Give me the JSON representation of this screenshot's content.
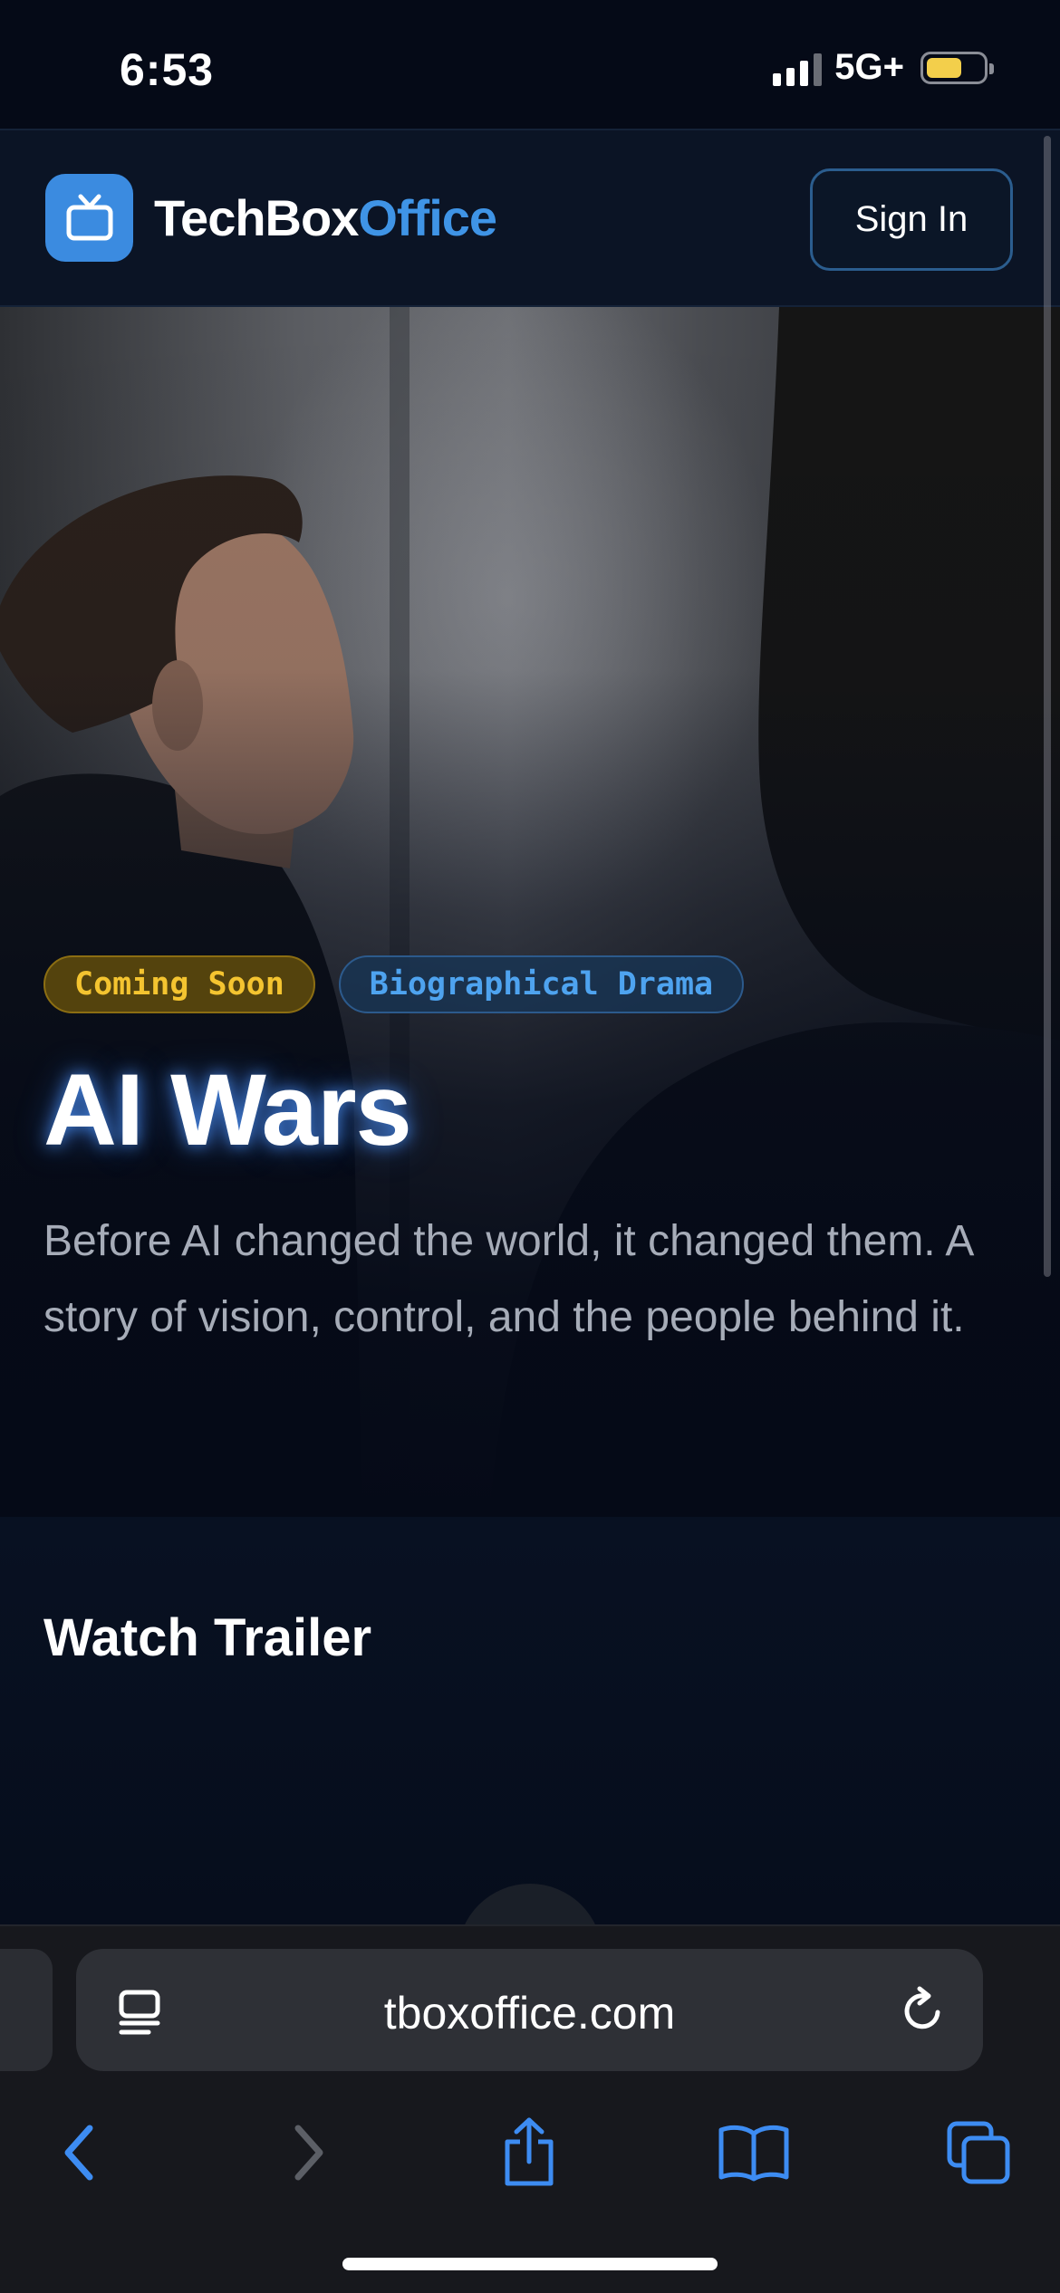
{
  "status_bar": {
    "time": "6:53",
    "network": "5G+",
    "battery_level": 0.55,
    "battery_color": "#f3cf4b"
  },
  "header": {
    "logo_icon": "tv-icon",
    "logo_text_white": "TechBox",
    "logo_text_blue": "Office",
    "sign_in_label": "Sign In",
    "accent_color": "#3f94e6"
  },
  "hero": {
    "badges": [
      "Coming Soon",
      "Biographical Drama"
    ],
    "title": "AI Wars",
    "description": "Before AI changed the world, it changed them. A story of vision, control, and the people behind it."
  },
  "trailer": {
    "heading": "Watch Trailer"
  },
  "browser": {
    "url": "tboxoffice.com",
    "reader_icon": "reader-mode-icon",
    "reload_icon": "reload-icon",
    "toolbar_icons": [
      "back-icon",
      "forward-icon",
      "share-icon",
      "bookmarks-icon",
      "tabs-icon"
    ]
  }
}
